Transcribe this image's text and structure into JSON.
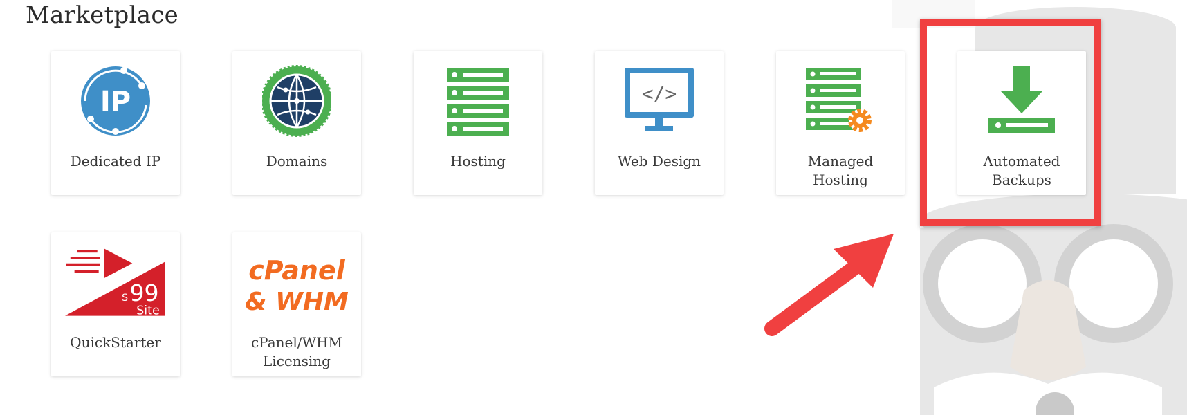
{
  "page": {
    "title": "Marketplace"
  },
  "tiles": [
    {
      "label": "Dedicated IP",
      "icon": "dedicated-ip-icon"
    },
    {
      "label": "Domains",
      "icon": "globe-seal-icon"
    },
    {
      "label": "Hosting",
      "icon": "server-rack-icon"
    },
    {
      "label": "Web Design",
      "icon": "code-monitor-icon"
    },
    {
      "label": "Managed\nHosting",
      "icon": "server-gear-icon"
    },
    {
      "label": "Automated\nBackups",
      "icon": "download-drive-icon"
    },
    {
      "label": "QuickStarter",
      "icon": "quickstarter-99-site-icon"
    },
    {
      "label": "cPanel/WHM\nLicensing",
      "icon": "cpanel-whm-logo-icon"
    }
  ],
  "icon_text": {
    "ip": "IP",
    "code": "</>",
    "price_currency": "$",
    "price": "99",
    "price_unit": "Site",
    "cpanel_line1": "cPanel",
    "cpanel_line2": "& WHM"
  },
  "colors": {
    "highlight": "#f04040",
    "green": "#4caf50",
    "blue": "#3f8fc8",
    "orange": "#f58a1f",
    "red": "#d4202a",
    "cpanel_orange": "#f26b21"
  }
}
